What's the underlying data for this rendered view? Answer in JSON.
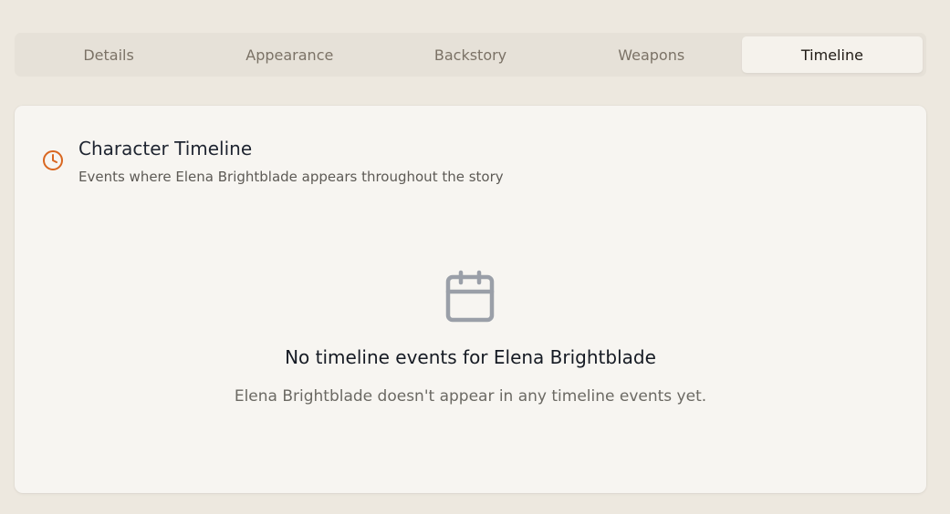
{
  "tabs": [
    {
      "label": "Details"
    },
    {
      "label": "Appearance"
    },
    {
      "label": "Backstory"
    },
    {
      "label": "Weapons"
    },
    {
      "label": "Timeline"
    }
  ],
  "active_tab": "Timeline",
  "timeline": {
    "icon": "clock-icon",
    "title": "Character Timeline",
    "subtitle": "Events where Elena Brightblade appears throughout the story"
  },
  "empty_state": {
    "icon": "calendar-icon",
    "title": "No timeline events for Elena Brightblade",
    "message": "Elena Brightblade doesn't appear in any timeline events yet."
  },
  "colors": {
    "background": "#ede8df",
    "accent": "#d9661f",
    "icon_muted": "#9a9fa8"
  }
}
